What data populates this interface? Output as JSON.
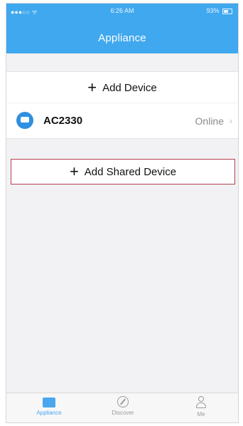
{
  "status_bar": {
    "carrier": "●●●○○ ᯤ",
    "time": "6:26 AM",
    "battery": "93%"
  },
  "header": {
    "title": "Appliance"
  },
  "add_device": {
    "label": "Add Device",
    "icon": "plus-icon"
  },
  "devices": [
    {
      "name": "AC2330",
      "status": "Online",
      "icon": "appliance-icon"
    }
  ],
  "add_shared_device": {
    "label": "Add Shared Device",
    "icon": "plus-icon"
  },
  "tabbar": {
    "items": [
      {
        "label": "Appliance",
        "icon": "appliance-icon",
        "active": true
      },
      {
        "label": "Discover",
        "icon": "compass-icon",
        "active": false
      },
      {
        "label": "Me",
        "icon": "user-icon",
        "active": false
      }
    ]
  },
  "colors": {
    "header_bg": "#40a8ee",
    "device_icon": "#2f8fe0",
    "highlight_border": "#b5404e",
    "active_tab": "#4aa6ee"
  }
}
